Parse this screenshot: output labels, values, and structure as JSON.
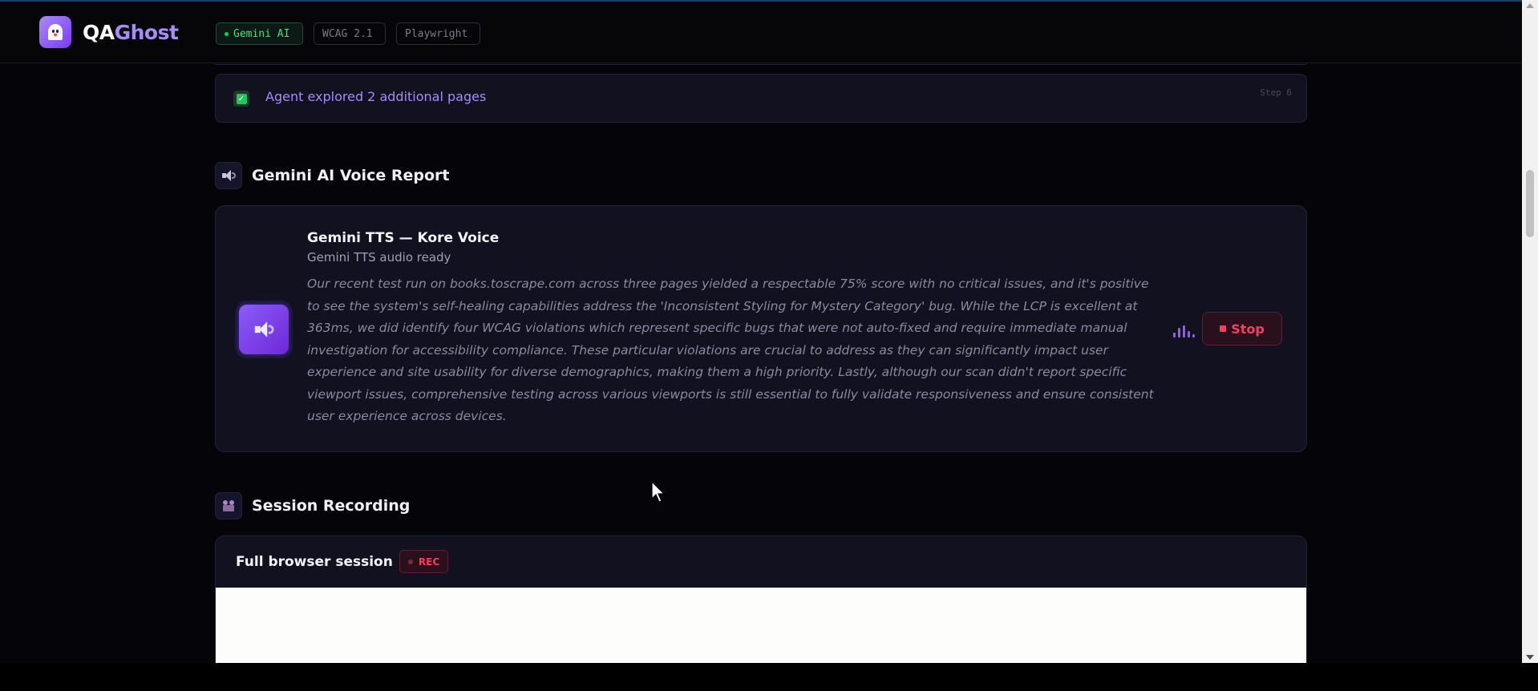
{
  "header": {
    "brand_qa": "QA",
    "brand_ghost": "Ghost",
    "badges": {
      "gemini": "Gemini AI",
      "wcag": "WCAG 2.1",
      "playwright": "Playwright"
    }
  },
  "step": {
    "text": "Agent explored 2 additional pages",
    "label": "Step 6"
  },
  "voice_section": {
    "title": "Gemini AI Voice Report",
    "card_title": "Gemini TTS — Kore Voice",
    "status": "Gemini TTS audio ready",
    "transcript": "Our recent test run on books.toscrape.com across three pages yielded a respectable 75% score with no critical issues, and it's positive to see the system's self-healing capabilities address the 'Inconsistent Styling for Mystery Category' bug. While the LCP is excellent at 363ms, we did identify four WCAG violations which represent specific bugs that were not auto-fixed and require immediate manual investigation for accessibility compliance. These particular violations are crucial to address as they can significantly impact user experience and site usability for diverse demographics, making them a high priority. Lastly, although our scan didn't report specific viewport issues, comprehensive testing across various viewports is still essential to fully validate responsiveness and ensure consistent user experience across devices.",
    "stop_label": "Stop"
  },
  "recording_section": {
    "title": "Session Recording",
    "card_title": "Full browser session",
    "rec_label": "REC"
  },
  "icons": {
    "logo": "ghost-icon",
    "step": "check-icon",
    "voice": "speaker-icon",
    "recording": "video-camera-icon",
    "stop": "stop-icon"
  },
  "colors": {
    "accent": "#a78bfa",
    "success": "#22c55e",
    "danger": "#f43f5e",
    "background": "#050509",
    "card": "#11111f"
  }
}
